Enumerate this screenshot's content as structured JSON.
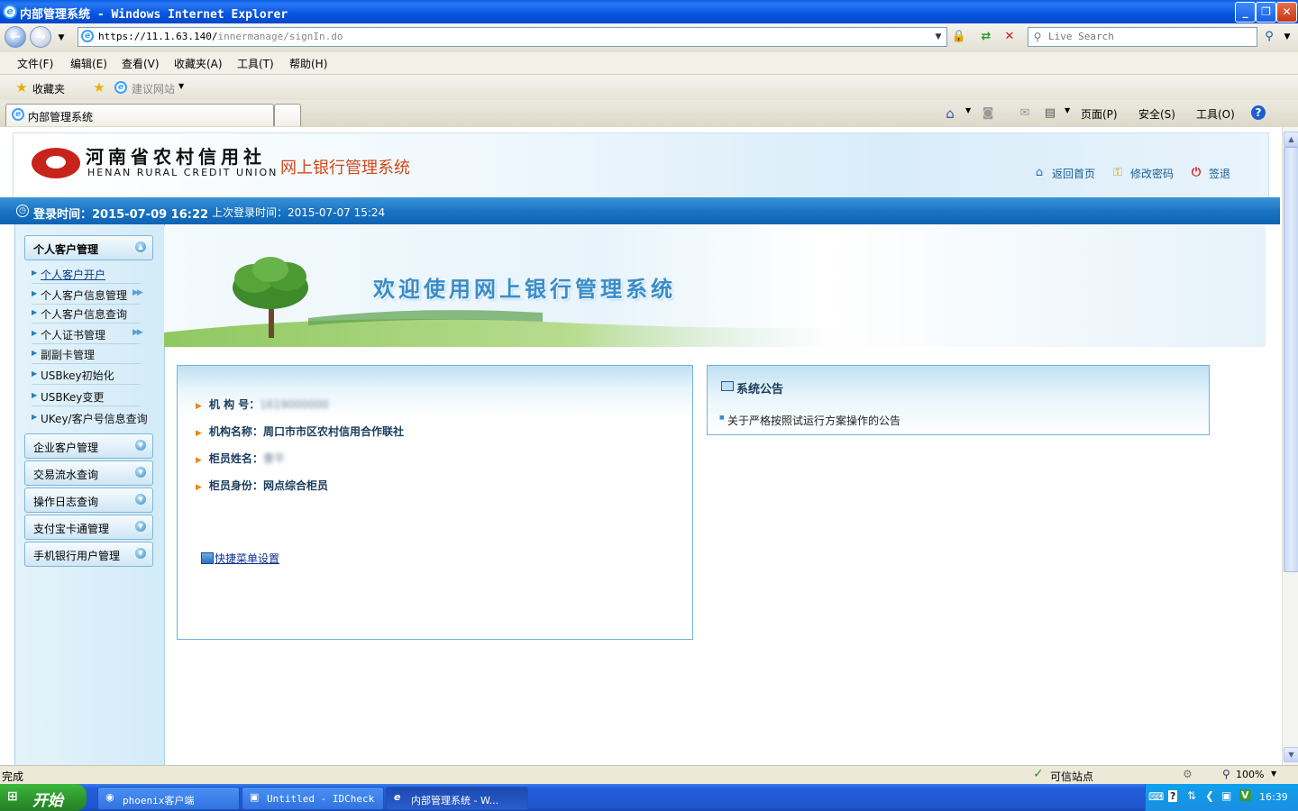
{
  "window": {
    "title": "内部管理系统 - Windows Internet Explorer",
    "btn_min": "_",
    "btn_max": "❐",
    "btn_close": "✕"
  },
  "browser": {
    "url_host": "https://11.1.63.140/",
    "url_path": "innermanage/signIn.do",
    "search_placeholder": "Live Search",
    "menu": [
      "文件(F)",
      "编辑(E)",
      "查看(V)",
      "收藏夹(A)",
      "工具(T)",
      "帮助(H)"
    ],
    "favorites_label": "收藏夹",
    "suggested_sites": "建议网站",
    "tab_title": "内部管理系统",
    "commands": {
      "page": "页面(P)",
      "safety": "安全(S)",
      "tools": "工具(O)",
      "help": "?"
    }
  },
  "header": {
    "logo_cn": "河南省农村信用社",
    "logo_en": "HENAN RURAL CREDIT UNION",
    "system_name": "网上银行管理系统",
    "links": {
      "home": "返回首页",
      "change_password": "修改密码",
      "logout": "签退"
    }
  },
  "timebar": {
    "login_time": "登录时间：2015-07-09 16:22",
    "last_login": "上次登录时间：2015-07-07 15:24"
  },
  "sidebar": {
    "personal": {
      "title": "个人客户管理",
      "items": [
        "个人客户开户",
        "个人客户信息管理",
        "个人客户信息查询",
        "个人证书管理",
        "副副卡管理",
        "USBkey初始化",
        "USBKey变更",
        "UKey/客户号信息查询"
      ]
    },
    "sections": [
      "企业客户管理",
      "交易流水查询",
      "操作日志查询",
      "支付宝卡通管理",
      "手机银行用户管理"
    ]
  },
  "banner": {
    "welcome": "欢迎使用网上银行管理系统"
  },
  "info": {
    "org_no_label": "机 构 号：",
    "org_no_value": "1619000000",
    "org_name_label": "机构名称：",
    "org_name_value": "周口市市区农村信用合作联社",
    "teller_name_label": "柜员姓名：",
    "teller_name_value": "曹平",
    "teller_role_label": "柜员身份：",
    "teller_role_value": "网点综合柜员",
    "quick_menu": "快捷菜单设置"
  },
  "notice": {
    "title": "系统公告",
    "items": [
      "关于严格按照试运行方案操作的公告"
    ]
  },
  "statusbar": {
    "text": "完成",
    "zone": "可信站点",
    "zoom": "100%"
  },
  "taskbar": {
    "start": "开始",
    "tasks": [
      "phoenix客户端",
      "Untitled - IDCheck",
      "内部管理系统 - W..."
    ],
    "clock": "16:39"
  }
}
